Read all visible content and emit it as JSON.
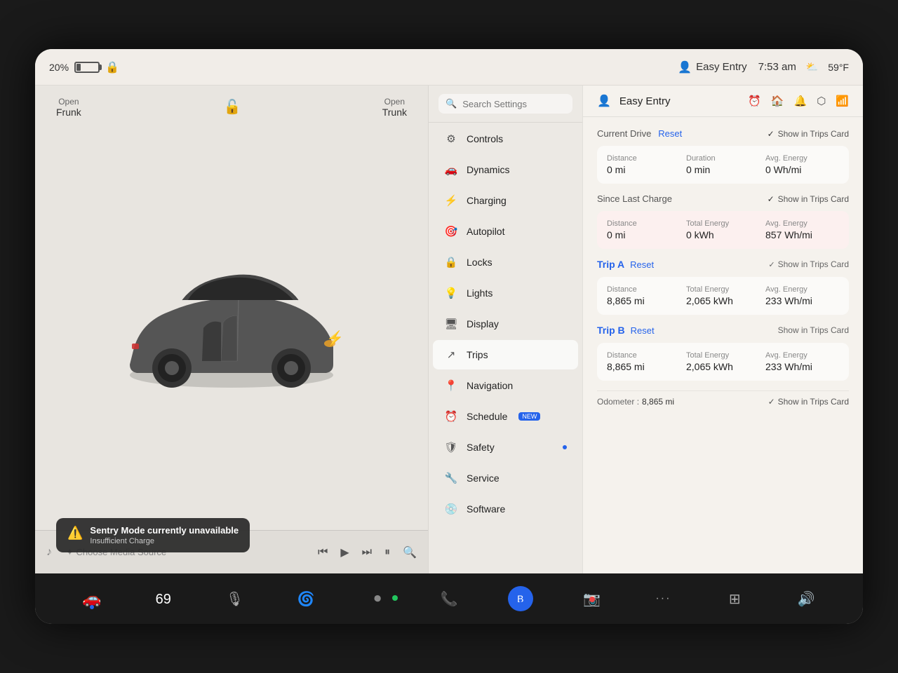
{
  "statusBar": {
    "battery": "20%",
    "lockIcon": "🔒",
    "easyEntry": "Easy Entry",
    "time": "7:53 am",
    "temp": "59°F"
  },
  "carPanel": {
    "openFrunk": "Open\nFrunk",
    "openTrunk": "Open\nTrunk",
    "sentryAlert": {
      "title": "Sentry Mode currently unavailable",
      "subtitle": "Insufficient Charge"
    }
  },
  "mediaBar": {
    "chooseMedia": "✦ Choose Media Source"
  },
  "settings": {
    "searchPlaceholder": "Search Settings",
    "items": [
      {
        "icon": "⚙️",
        "label": "Controls"
      },
      {
        "icon": "🚗",
        "label": "Dynamics"
      },
      {
        "icon": "⚡",
        "label": "Charging"
      },
      {
        "icon": "🎯",
        "label": "Autopilot"
      },
      {
        "icon": "🔒",
        "label": "Locks"
      },
      {
        "icon": "💡",
        "label": "Lights"
      },
      {
        "icon": "🖥️",
        "label": "Display"
      },
      {
        "icon": "🗺️",
        "label": "Trips",
        "active": true
      },
      {
        "icon": "📍",
        "label": "Navigation"
      },
      {
        "icon": "📅",
        "label": "Schedule",
        "badge": "NEW"
      },
      {
        "icon": "🛡️",
        "label": "Safety",
        "dot": true
      },
      {
        "icon": "🔧",
        "label": "Service"
      },
      {
        "icon": "💿",
        "label": "Software"
      }
    ]
  },
  "trips": {
    "headerTitle": "Easy Entry",
    "currentDrive": {
      "label": "Current Drive",
      "resetLabel": "Reset",
      "showInTrips": "Show in Trips Card",
      "distance": {
        "label": "Distance",
        "value": "0 mi"
      },
      "duration": {
        "label": "Duration",
        "value": "0 min"
      },
      "avgEnergy": {
        "label": "Avg. Energy",
        "value": "0 Wh/mi"
      }
    },
    "sinceLastCharge": {
      "label": "Since Last Charge",
      "showInTrips": "Show in Trips Card",
      "distance": {
        "label": "Distance",
        "value": "0 mi"
      },
      "totalEnergy": {
        "label": "Total Energy",
        "value": "0 kWh"
      },
      "avgEnergy": {
        "label": "Avg. Energy",
        "value": "857 Wh/mi"
      }
    },
    "tripA": {
      "label": "Trip A",
      "resetLabel": "Reset",
      "showInTrips": "Show in Trips Card",
      "distance": {
        "label": "Distance",
        "value": "8,865 mi"
      },
      "totalEnergy": {
        "label": "Total Energy",
        "value": "2,065 kWh"
      },
      "avgEnergy": {
        "label": "Avg. Energy",
        "value": "233 Wh/mi"
      }
    },
    "tripB": {
      "label": "Trip B",
      "resetLabel": "Reset",
      "showInTrips": "Show in Trips Card",
      "distance": {
        "label": "Distance",
        "value": "8,865 mi"
      },
      "totalEnergy": {
        "label": "Total Energy",
        "value": "2,065 kWh"
      },
      "avgEnergy": {
        "label": "Avg. Energy",
        "value": "233 Wh/mi"
      }
    },
    "odometer": {
      "label": "Odometer :",
      "value": "8,865 mi",
      "showInTrips": "Show in Trips Card"
    }
  },
  "taskbar": {
    "items": [
      {
        "icon": "🚗",
        "active": true,
        "hasDot": true
      },
      {
        "label": "69"
      },
      {
        "icon": "🎙️"
      },
      {
        "icon": "🌀"
      },
      {
        "icon": "⏺️",
        "hasGreenDot": true
      },
      {
        "icon": "📞",
        "hasGreenDot": true
      },
      {
        "icon": "⬡",
        "isBlue": true
      },
      {
        "icon": "📷"
      },
      {
        "icon": "···"
      },
      {
        "icon": "⊞"
      },
      {
        "icon": "🔊"
      }
    ]
  }
}
